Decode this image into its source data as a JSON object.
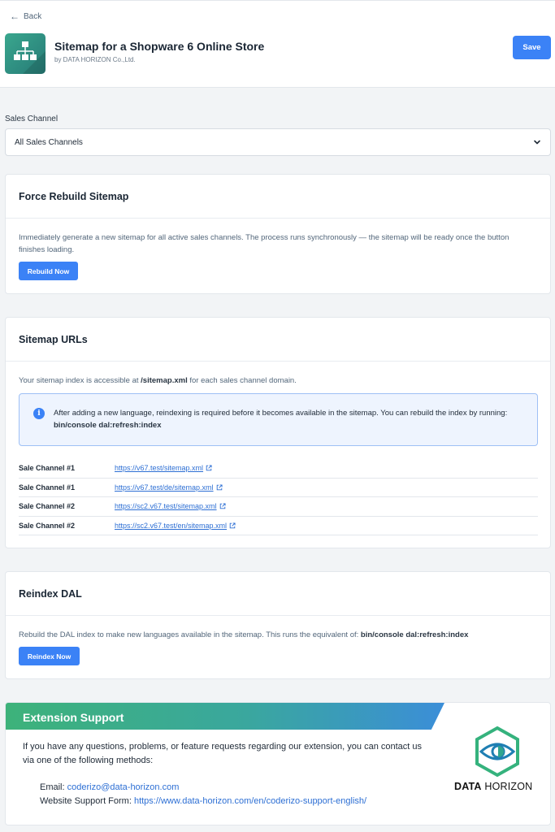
{
  "header": {
    "back_label": "Back",
    "title": "Sitemap for a Shopware 6 Online Store",
    "vendor": "by DATA HORIZON Co.,Ltd.",
    "save_label": "Save"
  },
  "sales_channel": {
    "label": "Sales Channel",
    "selected": "All Sales Channels"
  },
  "force_rebuild": {
    "title": "Force Rebuild Sitemap",
    "description": "Immediately generate a new sitemap for all active sales channels. The process runs synchronously — the sitemap will be ready once the button finishes loading.",
    "button_label": "Rebuild Now"
  },
  "sitemap_urls": {
    "title": "Sitemap URLs",
    "intro_prefix": "Your sitemap index is accessible at ",
    "intro_path": "/sitemap.xml",
    "intro_suffix": " for each sales channel domain.",
    "info_text": "After adding a new language, reindexing is required before it becomes available in the sitemap. You can rebuild the index by running: ",
    "info_command": "bin/console dal:refresh:index",
    "rows": [
      {
        "channel": "Sale Channel #1",
        "url": "https://v67.test/sitemap.xml"
      },
      {
        "channel": "Sale Channel #1",
        "url": "https://v67.test/de/sitemap.xml"
      },
      {
        "channel": "Sale Channel #2",
        "url": "https://sc2.v67.test/sitemap.xml"
      },
      {
        "channel": "Sale Channel #2",
        "url": "https://sc2.v67.test/en/sitemap.xml"
      }
    ]
  },
  "reindex": {
    "title": "Reindex DAL",
    "description": "Rebuild the DAL index to make new languages available in the sitemap. This runs the equivalent of: ",
    "command": "bin/console dal:refresh:index",
    "button_label": "Reindex Now"
  },
  "support": {
    "title": "Extension Support",
    "text": "If you have any questions, problems, or feature requests regarding our extension, you can contact us via one of the following methods:",
    "email_label": "Email: ",
    "email": "coderizo@data-horizon.com",
    "form_label": "Website Support Form: ",
    "form_url": "https://www.data-horizon.com/en/coderizo-support-english/",
    "brand_bold": "DATA",
    "brand_regular": "HORIZON"
  },
  "colors": {
    "primary": "#3b82f6",
    "link": "#2d6fd4",
    "brand_green": "#3db27a",
    "brand_teal": "#2e8c80"
  }
}
